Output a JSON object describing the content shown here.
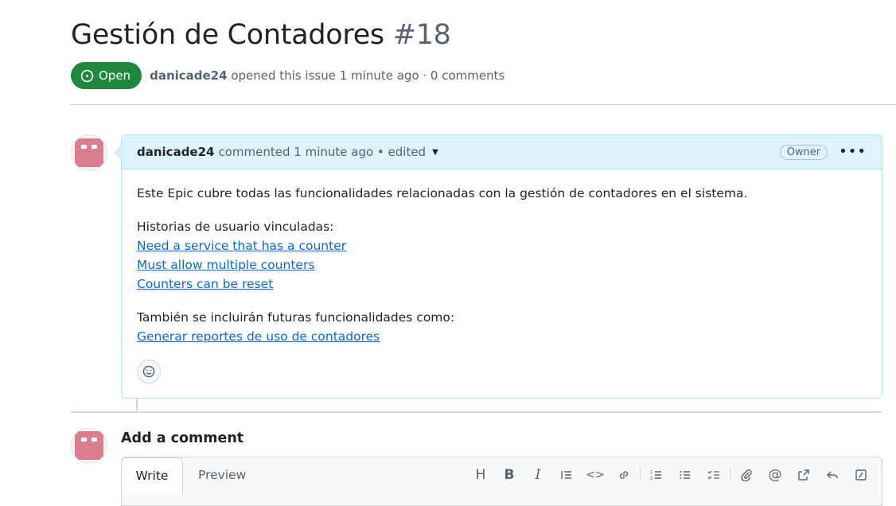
{
  "issue": {
    "title": "Gestión de Contadores",
    "number": "#18",
    "state": "Open",
    "author": "danicade24",
    "meta_text": "opened this issue 1 minute ago · 0 comments"
  },
  "comment": {
    "author": "danicade24",
    "meta": "commented 1 minute ago • edited",
    "role_badge": "Owner",
    "more": "•••",
    "intro": "Este Epic cubre todas las funcionalidades relacionadas con la gestión de contadores en el sistema.",
    "stories_heading": "Historias de usuario vinculadas:",
    "story_links": [
      "Need a service that has a counter",
      "Must allow multiple counters",
      "Counters can be reset"
    ],
    "future_heading": "También se incluirán futuras funcionalidades como:",
    "future_links": [
      "Generar reportes de uso de contadores"
    ]
  },
  "new_comment": {
    "title": "Add a comment",
    "tabs": [
      "Write",
      "Preview"
    ],
    "toolbar": [
      {
        "icon": "heading-icon",
        "glyph": "H"
      },
      {
        "icon": "bold-icon",
        "glyph": "B"
      },
      {
        "icon": "italic-icon",
        "glyph": "I"
      },
      {
        "icon": "quote-icon"
      },
      {
        "icon": "code-icon",
        "glyph": "<>"
      },
      {
        "icon": "link-icon"
      },
      {
        "icon": "ordered-list-icon"
      },
      {
        "icon": "unordered-list-icon"
      },
      {
        "icon": "task-list-icon"
      },
      {
        "icon": "attach-icon"
      },
      {
        "icon": "mention-icon",
        "glyph": "@"
      },
      {
        "icon": "cross-reference-icon"
      },
      {
        "icon": "saved-reply-icon"
      },
      {
        "icon": "slash-commands-icon"
      }
    ]
  },
  "colors": {
    "open_green": "#1f883d",
    "link_blue": "#0969da",
    "comment_header_bg": "#ddf4ff",
    "avatar_pink": "#dc7c8f"
  }
}
